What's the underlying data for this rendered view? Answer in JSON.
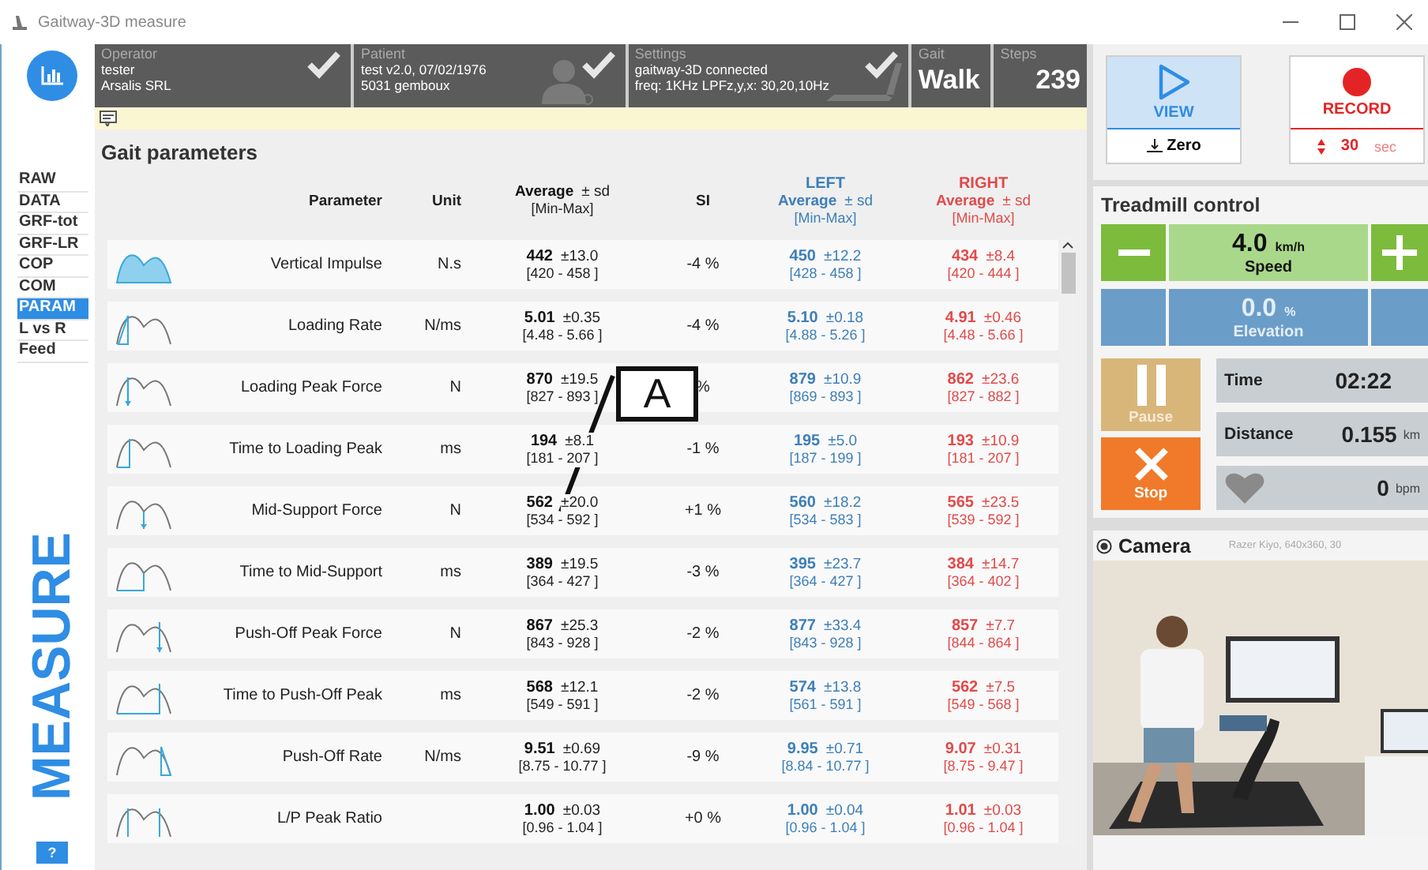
{
  "window": {
    "title": "Gaitway-3D measure"
  },
  "nav": {
    "items": [
      {
        "label": "RAW",
        "selected": false
      },
      {
        "label": "DATA",
        "selected": false
      },
      {
        "label": "GRF-tot",
        "selected": false
      },
      {
        "label": "GRF-LR",
        "selected": false
      },
      {
        "label": "COP",
        "selected": false
      },
      {
        "label": "COM",
        "selected": false
      },
      {
        "label": "PARAM",
        "selected": true
      },
      {
        "label": "L vs R",
        "selected": false
      },
      {
        "label": "Feed",
        "selected": false
      }
    ],
    "mode_label": "MEASURE",
    "help_button": "?"
  },
  "header": {
    "sections": [
      {
        "kind": "operator",
        "label": "Operator",
        "lines": [
          "tester",
          "Arsalis SRL"
        ],
        "checked": true
      },
      {
        "kind": "patient",
        "label": "Patient",
        "lines": [
          "test v2.0, 07/02/1976",
          "5031 gemboux"
        ],
        "checked": true
      },
      {
        "kind": "settings",
        "label": "Settings",
        "lines": [
          "gaitway-3D connected",
          "freq: 1KHz   LPFz,y,x: 30,20,10Hz"
        ],
        "checked": true
      },
      {
        "kind": "value",
        "label": "Gait",
        "value": "Walk"
      },
      {
        "kind": "value",
        "label": "Steps",
        "value": "239"
      }
    ]
  },
  "section_title": "Gait parameters",
  "annotation": {
    "label": "A"
  },
  "table": {
    "columns": [
      {
        "kind": "plain",
        "label": "Parameter"
      },
      {
        "kind": "plain",
        "label": "Unit"
      },
      {
        "kind": "stat",
        "average": "Average",
        "sd": "± sd",
        "range": "[Min-Max]"
      },
      {
        "kind": "plain",
        "label": "SI"
      },
      {
        "kind": "left",
        "title": "LEFT",
        "average": "Average",
        "sd": "± sd",
        "range": "[Min-Max]"
      },
      {
        "kind": "right",
        "title": "RIGHT",
        "average": "Average",
        "sd": "± sd",
        "range": "[Min-Max]"
      }
    ],
    "rows": [
      {
        "parameter": "Vertical Impulse",
        "unit": "N.s",
        "both": {
          "avg": "442",
          "sd": "±13.0",
          "range": "[420  - 458 ]"
        },
        "si": "-4 %",
        "left": {
          "avg": "450",
          "sd": "±12.2",
          "range": "[428  - 458 ]"
        },
        "right": {
          "avg": "434",
          "sd": "±8.4",
          "range": "[420  - 444 ]"
        }
      },
      {
        "parameter": "Loading Rate",
        "unit": "N/ms",
        "both": {
          "avg": "5.01",
          "sd": "±0.35",
          "range": "[4.48  - 5.66 ]"
        },
        "si": "-4 %",
        "left": {
          "avg": "5.10",
          "sd": "±0.18",
          "range": "[4.88  - 5.26 ]"
        },
        "right": {
          "avg": "4.91",
          "sd": "±0.46",
          "range": "[4.48  - 5.66 ]"
        }
      },
      {
        "parameter": "Loading Peak Force",
        "unit": "N",
        "both": {
          "avg": "870",
          "sd": "±19.5",
          "range": "[827  - 893 ]"
        },
        "si": "%",
        "left": {
          "avg": "879",
          "sd": "±10.9",
          "range": "[869  - 893 ]"
        },
        "right": {
          "avg": "862",
          "sd": "±23.6",
          "range": "[827  - 882 ]"
        }
      },
      {
        "parameter": "Time to Loading Peak",
        "unit": "ms",
        "both": {
          "avg": "194",
          "sd": "±8.1",
          "range": "[181  - 207 ]"
        },
        "si": "-1 %",
        "left": {
          "avg": "195",
          "sd": "±5.0",
          "range": "[187  - 199 ]"
        },
        "right": {
          "avg": "193",
          "sd": "±10.9",
          "range": "[181  - 207 ]"
        }
      },
      {
        "parameter": "Mid-Support Force",
        "unit": "N",
        "both": {
          "avg": "562",
          "sd": "±20.0",
          "range": "[534  - 592 ]"
        },
        "si": "+1 %",
        "left": {
          "avg": "560",
          "sd": "±18.2",
          "range": "[534  - 583 ]"
        },
        "right": {
          "avg": "565",
          "sd": "±23.5",
          "range": "[539  - 592 ]"
        }
      },
      {
        "parameter": "Time to Mid-Support",
        "unit": "ms",
        "both": {
          "avg": "389",
          "sd": "±19.5",
          "range": "[364  - 427 ]"
        },
        "si": "-3 %",
        "left": {
          "avg": "395",
          "sd": "±23.7",
          "range": "[364  - 427 ]"
        },
        "right": {
          "avg": "384",
          "sd": "±14.7",
          "range": "[364  - 402 ]"
        }
      },
      {
        "parameter": "Push-Off Peak Force",
        "unit": "N",
        "both": {
          "avg": "867",
          "sd": "±25.3",
          "range": "[843  - 928 ]"
        },
        "si": "-2 %",
        "left": {
          "avg": "877",
          "sd": "±33.4",
          "range": "[843  - 928 ]"
        },
        "right": {
          "avg": "857",
          "sd": "±7.7",
          "range": "[844  - 864 ]"
        }
      },
      {
        "parameter": "Time to Push-Off Peak",
        "unit": "ms",
        "both": {
          "avg": "568",
          "sd": "±12.1",
          "range": "[549  - 591 ]"
        },
        "si": "-2 %",
        "left": {
          "avg": "574",
          "sd": "±13.8",
          "range": "[561  - 591 ]"
        },
        "right": {
          "avg": "562",
          "sd": "±7.5",
          "range": "[549  - 568 ]"
        }
      },
      {
        "parameter": "Push-Off Rate",
        "unit": "N/ms",
        "both": {
          "avg": "9.51",
          "sd": "±0.69",
          "range": "[8.75  - 10.77 ]"
        },
        "si": "-9 %",
        "left": {
          "avg": "9.95",
          "sd": "±0.71",
          "range": "[8.84  - 10.77 ]"
        },
        "right": {
          "avg": "9.07",
          "sd": "±0.31",
          "range": "[8.75  - 9.47 ]"
        }
      },
      {
        "parameter": "L/P Peak Ratio",
        "both": {
          "avg": "1.00",
          "sd": "±0.03",
          "range": "[0.96  - 1.04 ]"
        },
        "si": "+0 %",
        "left": {
          "avg": "1.00",
          "sd": "±0.04",
          "range": "[0.96  - 1.04 ]"
        },
        "right": {
          "avg": "1.01",
          "sd": "±0.03",
          "range": "[0.96  - 1.04 ]"
        }
      }
    ]
  },
  "recording": {
    "view_button": "VIEW",
    "zero_button": "Zero",
    "record_button": "RECORD",
    "duration": "30",
    "duration_unit": "sec"
  },
  "treadmill": {
    "title": "Treadmill control",
    "rows": [
      {
        "kind": "speed",
        "value": "4.0",
        "unit": "km/h",
        "label": "Speed",
        "disabled": false
      },
      {
        "kind": "elevation",
        "value": "0.0",
        "unit": "%",
        "label": "Elevation",
        "disabled": true
      }
    ],
    "pause_button": {
      "label": "Pause",
      "disabled": true
    },
    "stop_button": {
      "label": "Stop",
      "disabled": false
    },
    "stats": [
      {
        "kind": "time",
        "label": "Time",
        "value": "02:22"
      },
      {
        "kind": "distance",
        "label": "Distance",
        "value": "0.155",
        "unit": "km"
      },
      {
        "kind": "heart",
        "value": "0",
        "unit": "bpm"
      }
    ]
  },
  "camera": {
    "selected": true,
    "title": "Camera",
    "info": "Razer Kiyo, 640x360, 30"
  }
}
